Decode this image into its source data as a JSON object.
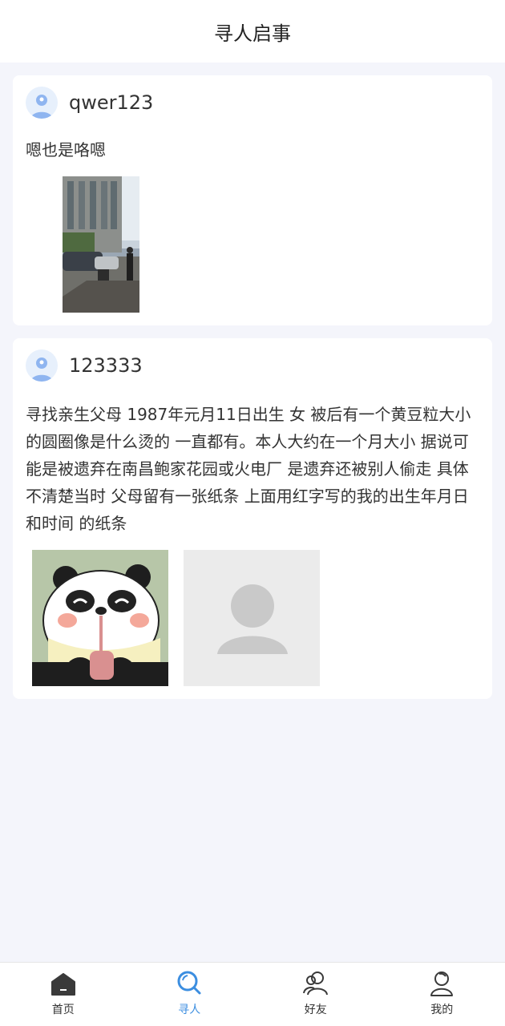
{
  "header": {
    "title": "寻人启事"
  },
  "posts": [
    {
      "username": "qwer123",
      "text": "嗯也是咯嗯",
      "images": [
        "street-photo"
      ]
    },
    {
      "username": "123333",
      "text": "寻找亲生父母 1987年元月11日出生 女 被后有一个黄豆粒大小的圆圈像是什么烫的 一直都有。本人大约在一个月大小 据说可能是被遗弃在南昌鲍家花园或火电厂 是遗弃还被别人偷走 具体不清楚当时 父母留有一张纸条 上面用红字写的我的出生年月日 和时间 的纸条",
      "images": [
        "panda-cartoon",
        "default-person-placeholder"
      ]
    }
  ],
  "tabbar": {
    "active": "寻人",
    "active_color": "#3c8ee0",
    "items": [
      {
        "label": "首页",
        "icon": "home-icon"
      },
      {
        "label": "寻人",
        "icon": "search-icon"
      },
      {
        "label": "好友",
        "icon": "friends-icon"
      },
      {
        "label": "我的",
        "icon": "profile-icon"
      }
    ]
  }
}
